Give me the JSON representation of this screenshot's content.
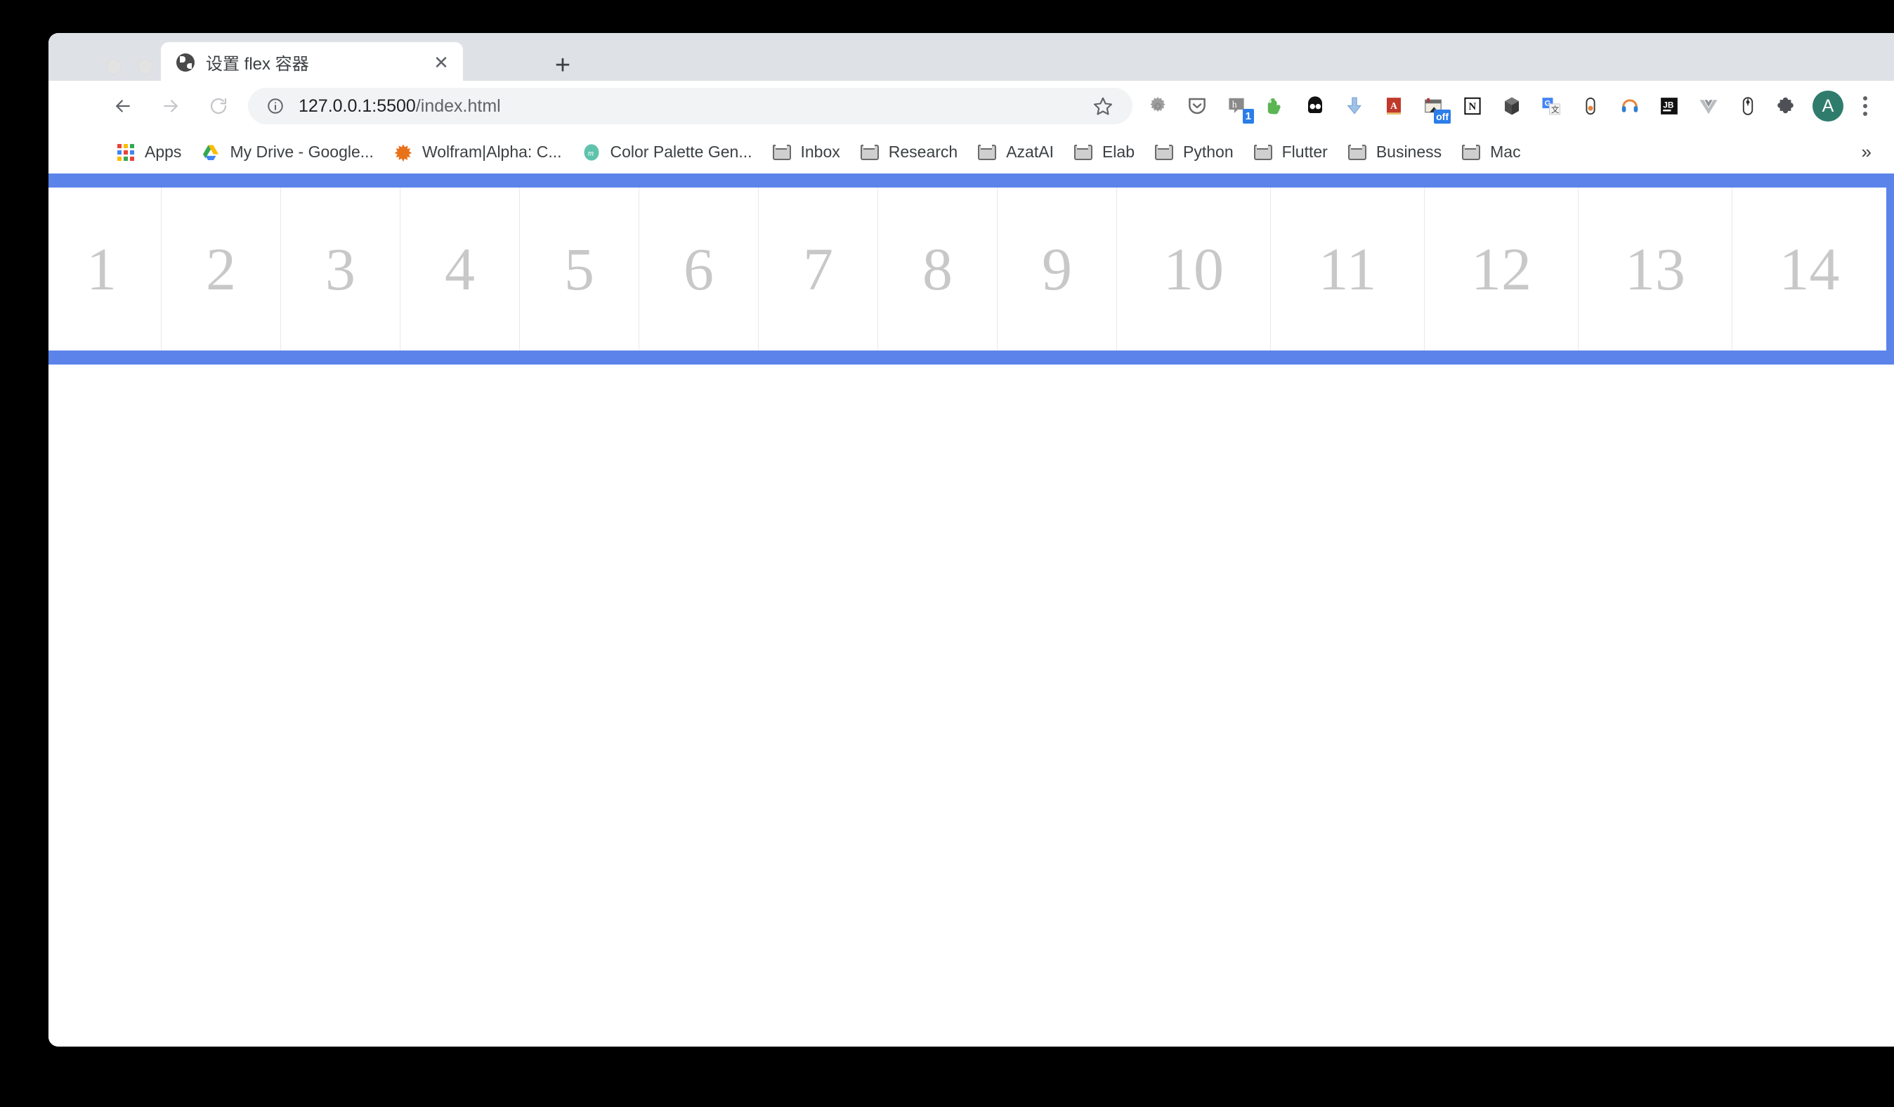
{
  "window": {
    "traffic_lights": [
      "close",
      "minimize",
      "maximize"
    ]
  },
  "tabs": [
    {
      "title": "设置 flex 容器",
      "favicon": "globe-icon",
      "close_label": "✕"
    }
  ],
  "newtab_label": "+",
  "toolbar": {
    "back_label": "back-arrow",
    "forward_label": "forward-arrow",
    "reload_label": "reload-arrow",
    "url_main": "127.0.0.1:5500",
    "url_path": "/index.html",
    "url_full": "127.0.0.1:5500/index.html",
    "site_info": "info-icon",
    "bookmark_star": "star-outline-icon",
    "avatar_letter": "A",
    "extensions": [
      {
        "name": "gear-extension-icon",
        "badge": ""
      },
      {
        "name": "pocket-extension-icon",
        "badge": ""
      },
      {
        "name": "hypothesis-extension-icon",
        "badge": "1"
      },
      {
        "name": "evernote-extension-icon",
        "badge": ""
      },
      {
        "name": "duckduckgo-extension-icon",
        "badge": ""
      },
      {
        "name": "download-extension-icon",
        "badge": ""
      },
      {
        "name": "dictionary-extension-icon",
        "badge": ""
      },
      {
        "name": "toggle-extension-icon",
        "badge": "off"
      },
      {
        "name": "notion-extension-icon",
        "badge": ""
      },
      {
        "name": "cube-extension-icon",
        "badge": ""
      },
      {
        "name": "google-translate-extension-icon",
        "badge": ""
      },
      {
        "name": "capsule-extension-icon",
        "badge": ""
      },
      {
        "name": "headphones-extension-icon",
        "badge": ""
      },
      {
        "name": "jetbrains-extension-icon",
        "badge": ""
      },
      {
        "name": "vue-devtools-extension-icon",
        "badge": ""
      },
      {
        "name": "mouse-extension-icon",
        "badge": ""
      },
      {
        "name": "puzzle-extensions-icon",
        "badge": ""
      }
    ]
  },
  "bookmarks": {
    "overflow_label": "»",
    "items": [
      {
        "label": "Apps",
        "icon": "apps-grid-icon"
      },
      {
        "label": "My Drive - Google...",
        "icon": "google-drive-icon"
      },
      {
        "label": "Wolfram|Alpha: C...",
        "icon": "wolfram-alpha-icon"
      },
      {
        "label": "Color Palette Gen...",
        "icon": "coolors-icon"
      },
      {
        "label": "Inbox",
        "icon": "folder-icon"
      },
      {
        "label": "Research",
        "icon": "folder-icon"
      },
      {
        "label": "AzatAI",
        "icon": "folder-icon"
      },
      {
        "label": "Elab",
        "icon": "folder-icon"
      },
      {
        "label": "Python",
        "icon": "folder-icon"
      },
      {
        "label": "Flutter",
        "icon": "folder-icon"
      },
      {
        "label": "Business",
        "icon": "folder-icon"
      },
      {
        "label": "Mac",
        "icon": "folder-icon"
      }
    ]
  },
  "page": {
    "container_color": "#5b83ea",
    "item_background": "#ffffff",
    "item_text_color": "#c8c8c8",
    "items": [
      {
        "label": "1",
        "width_class": "w1"
      },
      {
        "label": "2",
        "width_class": "w1"
      },
      {
        "label": "3",
        "width_class": "w1"
      },
      {
        "label": "4",
        "width_class": "w1"
      },
      {
        "label": "5",
        "width_class": "w1"
      },
      {
        "label": "6",
        "width_class": "w1"
      },
      {
        "label": "7",
        "width_class": "w1"
      },
      {
        "label": "8",
        "width_class": "w1"
      },
      {
        "label": "9",
        "width_class": "w1"
      },
      {
        "label": "10",
        "width_class": "w2"
      },
      {
        "label": "11",
        "width_class": "w2"
      },
      {
        "label": "12",
        "width_class": "w2"
      },
      {
        "label": "13",
        "width_class": "w2"
      },
      {
        "label": "14",
        "width_class": "w2"
      }
    ]
  }
}
